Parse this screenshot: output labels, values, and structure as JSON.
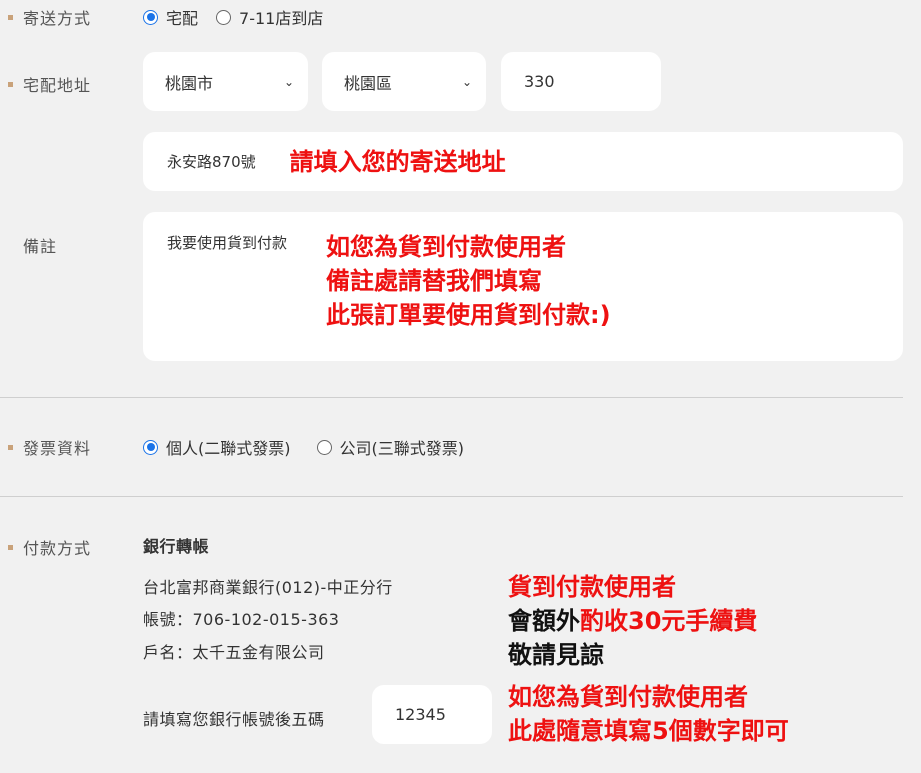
{
  "shipping": {
    "label": "寄送方式",
    "options": [
      "宅配",
      "7-11店到店"
    ],
    "selected": "宅配"
  },
  "address": {
    "label": "宅配地址",
    "city": "桃園市",
    "district": "桃園區",
    "zip": "330",
    "street": "永安路870號",
    "note": "請填入您的寄送地址"
  },
  "remarks": {
    "label": "備註",
    "value": "我要使用貨到付款",
    "note_lines": [
      "如您為貨到付款使用者",
      "備註處請替我們填寫",
      "此張訂單要使用貨到付款:)"
    ]
  },
  "invoice": {
    "label": "發票資料",
    "options": [
      "個人(二聯式發票)",
      "公司(三聯式發票)"
    ],
    "selected": "個人(二聯式發票)"
  },
  "payment": {
    "label": "付款方式",
    "method": "銀行轉帳",
    "bank": "台北富邦商業銀行(012)-中正分行",
    "account": "帳號：706-102-015-363",
    "holder": "戶名：太千五金有限公司",
    "cod_note_line1": "貨到付款使用者",
    "cod_note_line2_black": "會額外",
    "cod_note_line2_red": "酌收30元手續費",
    "cod_note_line3": "敬請見諒",
    "last5_label": "請填寫您銀行帳號後五碼",
    "last5_value": "12345",
    "last5_note_lines": [
      "如您為貨到付款使用者",
      "此處隨意填寫5個數字即可"
    ]
  },
  "colors": {
    "accent": "#1a73e8",
    "annotation_red": "#ee1111",
    "bullet": "#c9a27a"
  }
}
